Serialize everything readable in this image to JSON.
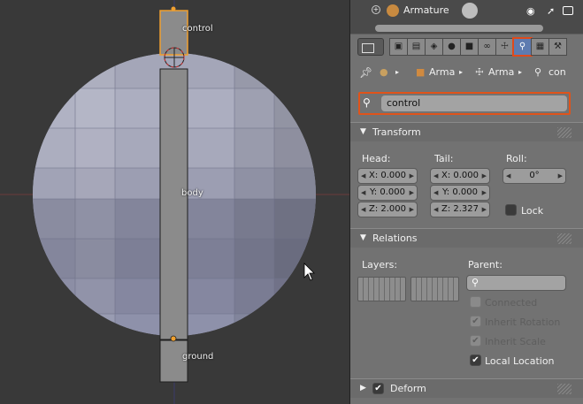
{
  "viewport": {
    "bones": [
      {
        "label": "control"
      },
      {
        "label": "body"
      },
      {
        "label": "ground"
      }
    ]
  },
  "outliner": {
    "expand_icon": "plus-icon",
    "object_name": "Armature",
    "object_icon": "armature-icon",
    "pose_icon": "pose-icon",
    "visibility_icon": "eye-icon",
    "select_icon": "cursor-icon",
    "render_icon": "camera-icon"
  },
  "tabs": [
    {
      "icon": "render-icon",
      "glyph": "▣"
    },
    {
      "icon": "render-layers-icon",
      "glyph": "▤"
    },
    {
      "icon": "scene-icon",
      "glyph": "◈"
    },
    {
      "icon": "world-icon",
      "glyph": "●"
    },
    {
      "icon": "object-icon",
      "glyph": "■"
    },
    {
      "icon": "constraints-icon",
      "glyph": "∞"
    },
    {
      "icon": "armature-data-icon",
      "glyph": "☩"
    },
    {
      "icon": "bone-icon",
      "glyph": "⚲"
    },
    {
      "icon": "texture-icon",
      "glyph": "▦"
    },
    {
      "icon": "bone-constraints-icon",
      "glyph": "⚒"
    }
  ],
  "breadcrumb": {
    "pin_icon": "pin-icon",
    "items": [
      {
        "label": "Arma",
        "icon": "object-icon"
      },
      {
        "label": "Arma",
        "icon": "armature-icon"
      },
      {
        "label": "con",
        "icon": "bone-icon"
      }
    ]
  },
  "bone_name": "control",
  "transform": {
    "title": "Transform",
    "head_label": "Head:",
    "tail_label": "Tail:",
    "roll_label": "Roll:",
    "head": [
      "X: 0.000",
      "Y: 0.000",
      "Z: 2.000"
    ],
    "tail": [
      "X: 0.000",
      "Y: 0.000",
      "Z: 2.327"
    ],
    "roll": "0°",
    "lock_label": "Lock",
    "lock_checked": false
  },
  "relations": {
    "title": "Relations",
    "layers_label": "Layers:",
    "parent_label": "Parent:",
    "connected_label": "Connected",
    "inherit_rotation_label": "Inherit Rotation",
    "inherit_scale_label": "Inherit Scale",
    "local_location_label": "Local Location",
    "connected": false,
    "inherit_rotation": true,
    "inherit_scale": true,
    "local_location": true
  },
  "deform": {
    "title": "Deform",
    "enabled": true
  },
  "colors": {
    "highlight": "#e0531a",
    "selected_bone": "#f0a030",
    "mesh": "#9a9cb4",
    "viewport_bg": "#393939",
    "panel_bg": "#727272"
  }
}
